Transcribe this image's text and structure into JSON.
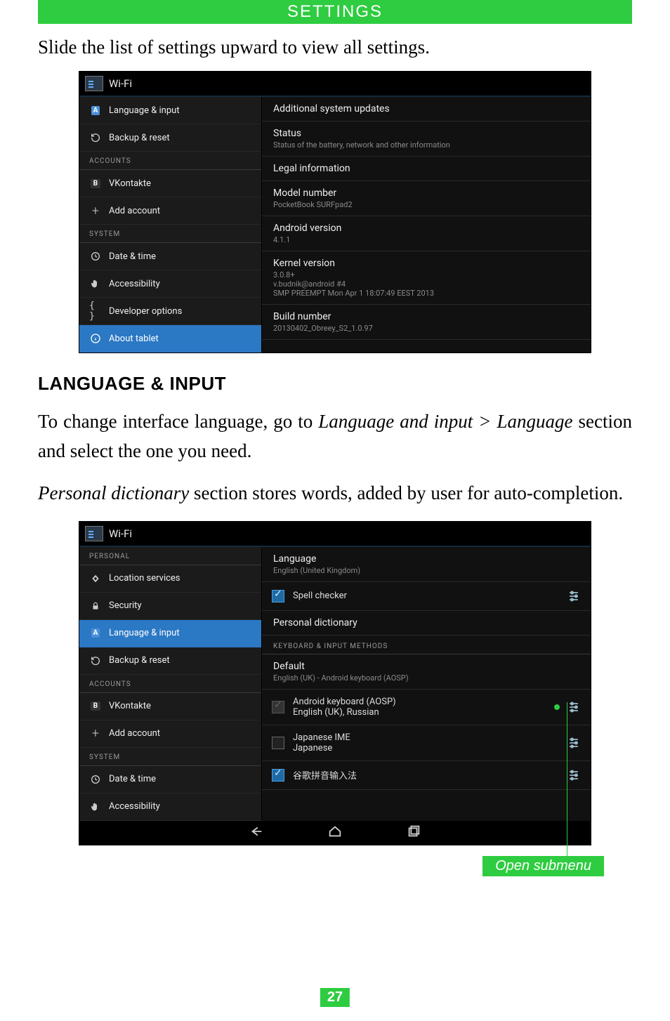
{
  "header": "SETTINGS",
  "intro": "Slide the list of settings upward to view all settings.",
  "shot1": {
    "title": "Wi-Fi",
    "left": {
      "items_top": [
        {
          "icon": "A-icon",
          "label": "Language & input"
        },
        {
          "icon": "reset-icon",
          "label": "Backup & reset"
        }
      ],
      "accounts_header": "ACCOUNTS",
      "items_accounts": [
        {
          "icon": "B-icon",
          "label": "VKontakte"
        },
        {
          "icon": "plus-icon",
          "label": "Add account"
        }
      ],
      "system_header": "SYSTEM",
      "items_system": [
        {
          "icon": "clock-icon",
          "label": "Date & time"
        },
        {
          "icon": "hand-icon",
          "label": "Accessibility"
        },
        {
          "icon": "braces-icon",
          "label": "Developer options"
        },
        {
          "icon": "info-icon",
          "label": "About tablet",
          "active": true
        }
      ]
    },
    "right": [
      {
        "primary": "Additional system updates"
      },
      {
        "primary": "Status",
        "secondary": "Status of the battery, network and other information"
      },
      {
        "primary": "Legal information"
      },
      {
        "primary": "Model number",
        "secondary": "PocketBook SURFpad2"
      },
      {
        "primary": "Android version",
        "secondary": "4.1.1"
      },
      {
        "primary": "Kernel version",
        "secondary": "3.0.8+\nv.budnik@android #4\nSMP PREEMPT Mon Apr 1 18:07:49 EEST 2013"
      },
      {
        "primary": "Build number",
        "secondary": "20130402_Obreey_S2_1.0.97"
      }
    ]
  },
  "section_title": "LANGUAGE & INPUT",
  "para1_pre": "To change interface language, go to ",
  "para1_it": "Language and input > Language",
  "para1_post": " section and select the one you need.",
  "para2_it": "Personal dictionary",
  "para2_post": " section stores words, added by user for auto-completion.",
  "shot2": {
    "title": "Wi-Fi",
    "left": {
      "personal_header": "PERSONAL",
      "items_personal": [
        {
          "icon": "diamond-icon",
          "label": "Location services"
        },
        {
          "icon": "lock-icon",
          "label": "Security"
        },
        {
          "icon": "A-icon",
          "label": "Language & input",
          "active": true
        },
        {
          "icon": "reset-icon",
          "label": "Backup & reset"
        }
      ],
      "accounts_header": "ACCOUNTS",
      "items_accounts": [
        {
          "icon": "B-icon",
          "label": "VKontakte"
        },
        {
          "icon": "plus-icon",
          "label": "Add account"
        }
      ],
      "system_header": "SYSTEM",
      "items_system": [
        {
          "icon": "clock-icon",
          "label": "Date & time"
        },
        {
          "icon": "hand-icon",
          "label": "Accessibility"
        }
      ]
    },
    "right": {
      "language": {
        "primary": "Language",
        "secondary": "English (United Kingdom)"
      },
      "spell": "Spell checker",
      "pd": "Personal dictionary",
      "kim_header": "KEYBOARD & INPUT METHODS",
      "default": {
        "primary": "Default",
        "secondary": "English (UK) - Android keyboard (AOSP)"
      },
      "ime": [
        {
          "label": "Android keyboard (AOSP)",
          "sub": "English (UK), Russian",
          "checked": "locked",
          "dot": true
        },
        {
          "label": "Japanese IME",
          "sub": "Japanese",
          "checked": "off"
        },
        {
          "label": "谷歌拼音输入法",
          "checked": "on"
        }
      ]
    }
  },
  "callout": "Open submenu",
  "page": "27"
}
